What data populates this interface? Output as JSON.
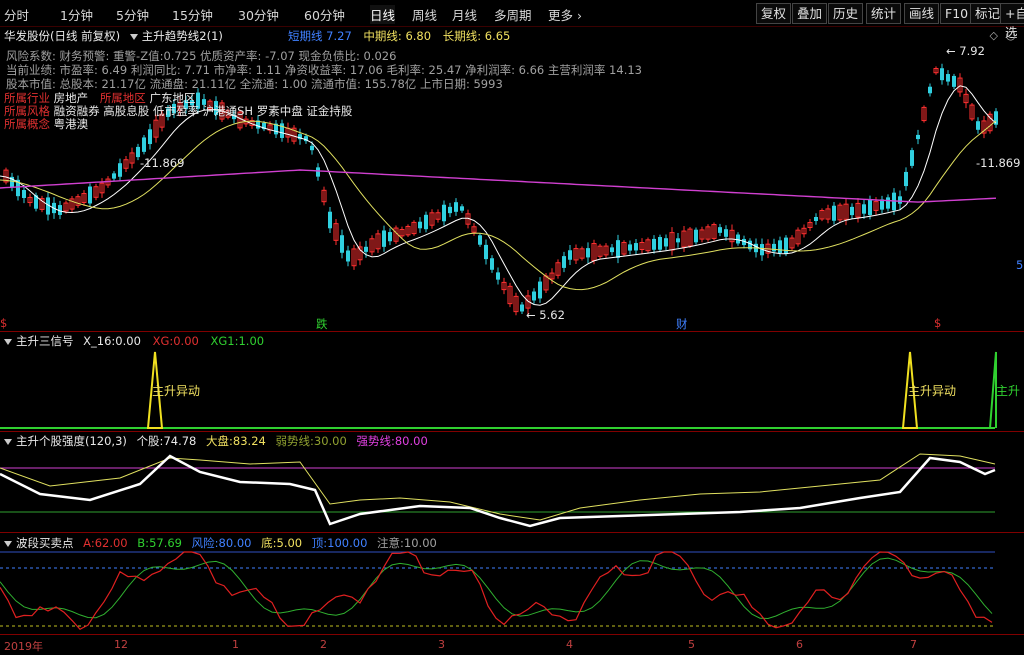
{
  "toolbar": {
    "periods": [
      "分时",
      "1分钟",
      "5分钟",
      "15分钟",
      "30分钟",
      "60分钟",
      "日线",
      "周线",
      "月线",
      "多周期",
      "更多"
    ],
    "active_period": "日线",
    "right_buttons": [
      "复权",
      "叠加",
      "历史",
      "统计",
      "画线",
      "F10",
      "标记",
      "+自选"
    ]
  },
  "header": {
    "stock": "华发股份(日线 前复权)",
    "indicator": "主升趋势线2(1)",
    "short_label": "短期线",
    "short_value": "7.27",
    "mid_label": "中期线:",
    "mid_value": "6.80",
    "long_label": "长期线:",
    "long_value": "6.65"
  },
  "info": {
    "line1": "风险系数: 财务预警: 重警-Z值:0.725 优质资产率: -7.07 现金负债比: 0.026",
    "line2": "当前业绩: 市盈率: 6.49 利润同比: 7.71 市净率: 1.11 净资收益率: 17.06 毛利率: 25.47 净利润率: 6.66 主营利润率 14.13",
    "line3": "股本市值: 总股本: 21.17亿 流通盘: 21.11亿 全流通: 1.00 流通市值: 155.78亿 上市日期: 5993",
    "industry_label": "所属行业",
    "industry_value": "房地产",
    "region_label": "所属地区",
    "region_value": "广东地区",
    "style_label": "所属风格",
    "style_value": "融资融券 高股息股 低市盈率 沪港通SH 罗素中盘 证金持股",
    "concept_label": "所属概念",
    "concept_value": "粤港澳"
  },
  "chart_labels": {
    "high_price": "7.92",
    "low_price": "5.62",
    "left_value": "-11.869",
    "right_value": "-11.869",
    "right_edge_marker": "5",
    "marker_die": "跌",
    "marker_cai": "财",
    "marker_s": "$"
  },
  "panel2": {
    "name": "主升三信号",
    "x16_label": "X_16:",
    "x16_value": "0.00",
    "xg_label": "XG:",
    "xg_value": "0.00",
    "xg1_label": "XG1:",
    "xg1_value": "1.00",
    "signal_text": "主升异动",
    "signal_text_right": "主升"
  },
  "panel3": {
    "name": "主升个股强度(120,3)",
    "stock_label": "个股:",
    "stock_value": "74.78",
    "market_label": "大盘:",
    "market_value": "83.24",
    "weak_label": "弱势线:",
    "weak_value": "30.00",
    "strong_label": "强势线:",
    "strong_value": "80.00"
  },
  "panel4": {
    "name": "波段买卖点",
    "a_label": "A:",
    "a_value": "62.00",
    "b_label": "B:",
    "b_value": "57.69",
    "risk_label": "风险:",
    "risk_value": "80.00",
    "bottom_label": "底:",
    "bottom_value": "5.00",
    "top_label": "顶:",
    "top_value": "100.00",
    "caution_label": "注意:",
    "caution_value": "10.00"
  },
  "x_axis": [
    "2019年",
    "12",
    "1",
    "2",
    "3",
    "4",
    "5",
    "6",
    "7"
  ],
  "colors": {
    "up": "#ff3030",
    "down": "#30d0e0",
    "ma_short": "#ffffff",
    "ma_mid": "#e0e060",
    "ma_long": "#d040d0",
    "divider": "#800000"
  }
}
